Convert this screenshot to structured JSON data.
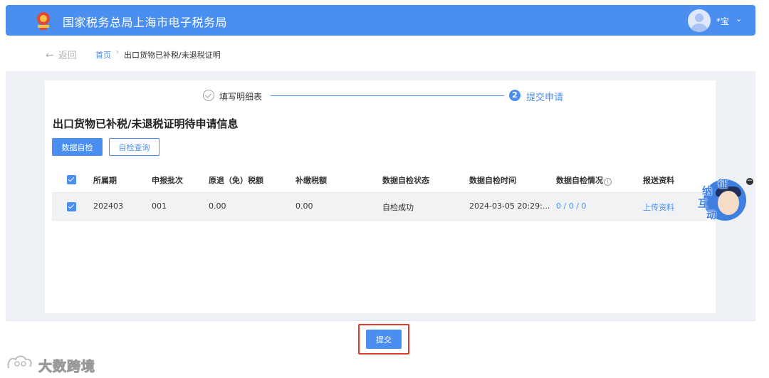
{
  "header": {
    "title": "国家税务总局上海市电子税务局",
    "user_name": "*宝",
    "caret": "⌄"
  },
  "breadcrumb": {
    "back_arrow": "←",
    "back_label": "返回",
    "home": "首页",
    "separator": "›",
    "current": "出口货物已补税/未退税证明"
  },
  "steps": [
    {
      "label": "填写明细表",
      "state": "done"
    },
    {
      "number": "2",
      "label": "提交申请",
      "state": "active"
    }
  ],
  "section_title": "出口货物已补税/未退税证明待申请信息",
  "toolbar": {
    "self_check": "数据自检",
    "check_query": "自检查询"
  },
  "table": {
    "headers": [
      "所属期",
      "申报批次",
      "原退（免）税额",
      "补缴税额",
      "数据自检状态",
      "数据自检时间",
      "数据自检情况",
      "报送资料"
    ],
    "info_icon": "i",
    "rows": [
      {
        "checked": true,
        "cells": [
          "202403",
          "001",
          "0.00",
          "0.00",
          "自检成功",
          "2024-03-05 20:29:...",
          "0 / 0 / 0",
          "上传资料"
        ]
      }
    ]
  },
  "float_widget": {
    "chars": [
      "征",
      "纳",
      "互",
      "动"
    ],
    "minus": "−"
  },
  "footer": {
    "submit": "提交"
  },
  "watermark": {
    "text": "大数跨境"
  },
  "colors": {
    "primary": "#4a8ff0",
    "highlight": "#e23b2e",
    "page_bg": "#eef1f6"
  }
}
